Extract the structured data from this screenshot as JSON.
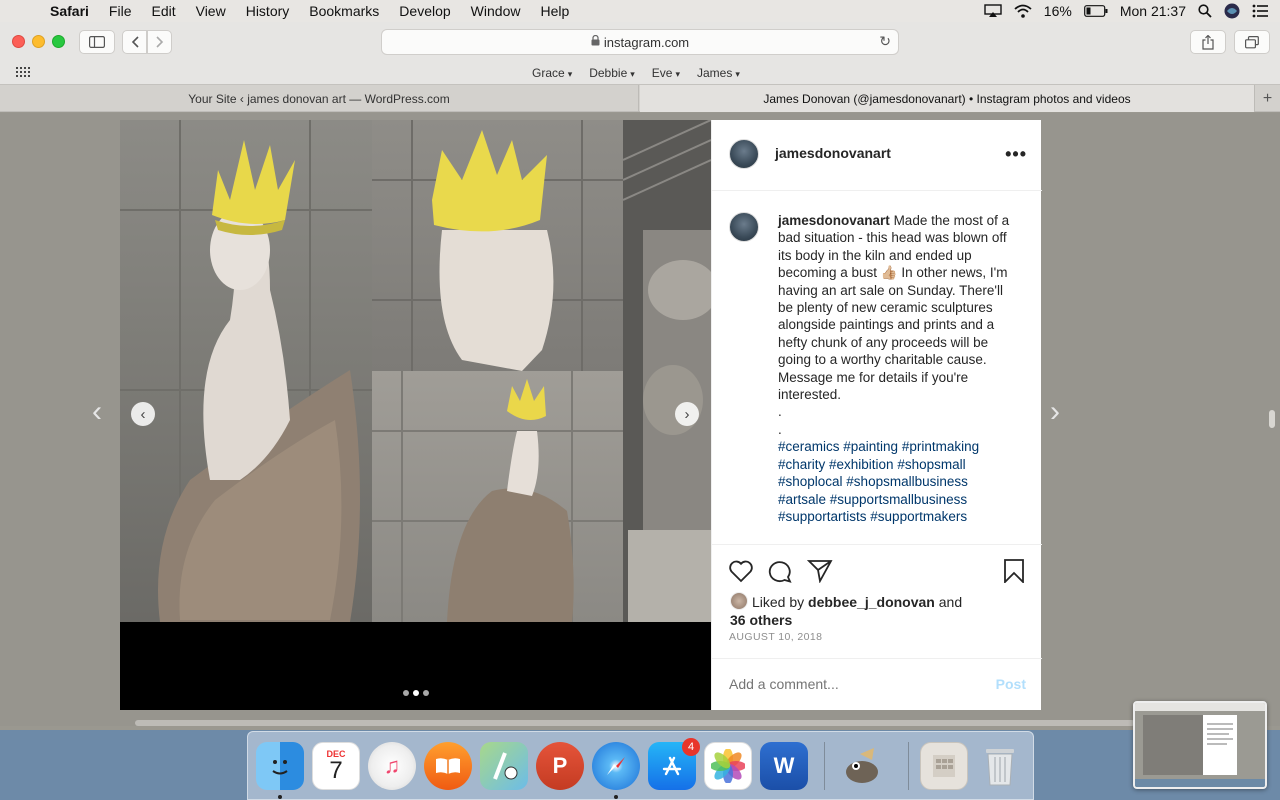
{
  "menubar": {
    "app": "Safari",
    "items": [
      "File",
      "Edit",
      "View",
      "History",
      "Bookmarks",
      "Develop",
      "Window",
      "Help"
    ],
    "battery": "16%",
    "clock": "Mon 21:37"
  },
  "browser": {
    "url": "instagram.com",
    "bookmarks": [
      "Grace",
      "Debbie",
      "Eve",
      "James"
    ],
    "tabs": [
      {
        "title": "Your Site ‹ james donovan art — WordPress.com"
      },
      {
        "title": "James Donovan (@jamesdonovanart) • Instagram photos and videos"
      }
    ]
  },
  "post": {
    "username": "jamesdonovanart",
    "caption_lines": [
      "Made the most of a bad situation - this head was blown off its body in the kiln and ended up becoming a bust 👍🏼 In other news, I'm having an art sale on Sunday. There'll be plenty of new ceramic sculptures alongside paintings and prints and a hefty chunk of any proceeds will be going to a worthy charitable cause. Message me for details if you're interested.",
      ".",
      "."
    ],
    "hashtags": "#ceramics #painting #printmaking #charity #exhibition #shopsmall #shoplocal #shopsmallbusiness #artsale #supportsmallbusiness #supportartists #supportmakers",
    "liked_prefix": "Liked by",
    "liked_by": "debbee_j_donovan",
    "liked_and": "and",
    "liked_others": "36 others",
    "date": "AUGUST 10, 2018",
    "comment_placeholder": "Add a comment...",
    "post_button": "Post",
    "carousel_active_index": 1
  },
  "dock": {
    "calendar_month": "DEC",
    "calendar_day": "7",
    "appstore_badge": "4"
  }
}
